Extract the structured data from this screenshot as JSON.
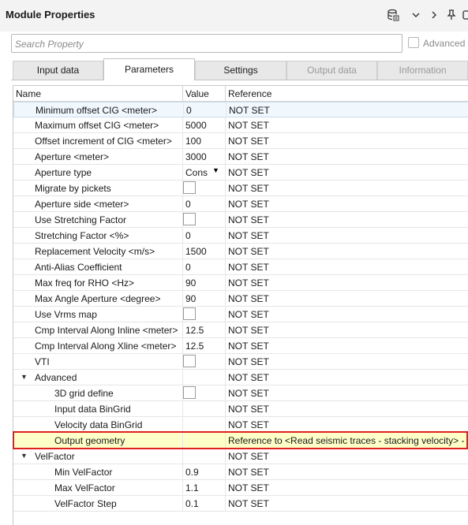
{
  "header": {
    "title": "Module Properties",
    "icons": [
      "database-icon",
      "chevron-down-icon",
      "chevron-right-icon",
      "pin-icon",
      "settings-icon"
    ]
  },
  "search": {
    "placeholder": "Search Property",
    "advanced_label": "Advanced",
    "advanced_checked": false
  },
  "tabs": [
    {
      "label": "Input data",
      "state": "normal"
    },
    {
      "label": "Parameters",
      "state": "active"
    },
    {
      "label": "Settings",
      "state": "normal"
    },
    {
      "label": "Output data",
      "state": "disabled"
    },
    {
      "label": "Information",
      "state": "disabled"
    }
  ],
  "table": {
    "columns": [
      "Name",
      "Value",
      "Reference"
    ],
    "rows": [
      {
        "name": "Minimum offset CIG <meter>",
        "value": "0",
        "reference": "NOT SET",
        "level": 0,
        "type": "text"
      },
      {
        "name": "Maximum offset CIG <meter>",
        "value": "5000",
        "reference": "NOT SET",
        "level": 0,
        "type": "text"
      },
      {
        "name": "Offset increment of CIG <meter>",
        "value": "100",
        "reference": "NOT SET",
        "level": 0,
        "type": "text"
      },
      {
        "name": "Aperture <meter>",
        "value": "3000",
        "reference": "NOT SET",
        "level": 0,
        "type": "text"
      },
      {
        "name": "Aperture type",
        "value": "Cons",
        "reference": "NOT SET",
        "level": 0,
        "type": "combo"
      },
      {
        "name": "Migrate by pickets",
        "value": "",
        "reference": "NOT SET",
        "level": 0,
        "type": "checkbox"
      },
      {
        "name": "Aperture side <meter>",
        "value": "0",
        "reference": "NOT SET",
        "level": 0,
        "type": "text"
      },
      {
        "name": "Use Stretching Factor",
        "value": "",
        "reference": "NOT SET",
        "level": 0,
        "type": "checkbox"
      },
      {
        "name": "Stretching Factor <%>",
        "value": "0",
        "reference": "NOT SET",
        "level": 0,
        "type": "text"
      },
      {
        "name": "Replacement Velocity <m/s>",
        "value": "1500",
        "reference": "NOT SET",
        "level": 0,
        "type": "text"
      },
      {
        "name": "Anti-Alias Coefficient",
        "value": "0",
        "reference": "NOT SET",
        "level": 0,
        "type": "text"
      },
      {
        "name": "Max freq for RHO <Hz>",
        "value": "90",
        "reference": "NOT SET",
        "level": 0,
        "type": "text"
      },
      {
        "name": "Max Angle Aperture <degree>",
        "value": "90",
        "reference": "NOT SET",
        "level": 0,
        "type": "text"
      },
      {
        "name": "Use Vrms map",
        "value": "",
        "reference": "NOT SET",
        "level": 0,
        "type": "checkbox"
      },
      {
        "name": "Cmp Interval Along Inline <meter>",
        "value": "12.5",
        "reference": "NOT SET",
        "level": 0,
        "type": "text"
      },
      {
        "name": "Cmp Interval Along Xline <meter>",
        "value": "12.5",
        "reference": "NOT SET",
        "level": 0,
        "type": "text"
      },
      {
        "name": "VTI",
        "value": "",
        "reference": "NOT SET",
        "level": 0,
        "type": "checkbox"
      },
      {
        "name": "Advanced",
        "value": "",
        "reference": "NOT SET",
        "level": 0,
        "type": "group"
      },
      {
        "name": "3D grid define",
        "value": "",
        "reference": "NOT SET",
        "level": 1,
        "type": "checkbox"
      },
      {
        "name": "Input data BinGrid",
        "value": "",
        "reference": "NOT SET",
        "level": 1,
        "type": "text"
      },
      {
        "name": "Velocity data BinGrid",
        "value": "",
        "reference": "NOT SET",
        "level": 1,
        "type": "text"
      },
      {
        "name": "Output geometry",
        "value": "",
        "reference": "Reference to <Read seismic traces - stacking velocity> - <",
        "level": 1,
        "type": "text",
        "highlight": true
      },
      {
        "name": "VelFactor",
        "value": "",
        "reference": "NOT SET",
        "level": 0,
        "type": "group"
      },
      {
        "name": "Min VelFactor",
        "value": "0.9",
        "reference": "NOT SET",
        "level": 1,
        "type": "text"
      },
      {
        "name": "Max VelFactor",
        "value": "1.1",
        "reference": "NOT SET",
        "level": 1,
        "type": "text"
      },
      {
        "name": "VelFactor Step",
        "value": "0.1",
        "reference": "NOT SET",
        "level": 1,
        "type": "text"
      }
    ]
  },
  "colors": {
    "highlight_row": "#ffffc8",
    "selection_border": "#e0201f",
    "header_bg": "#f3f3f3"
  }
}
